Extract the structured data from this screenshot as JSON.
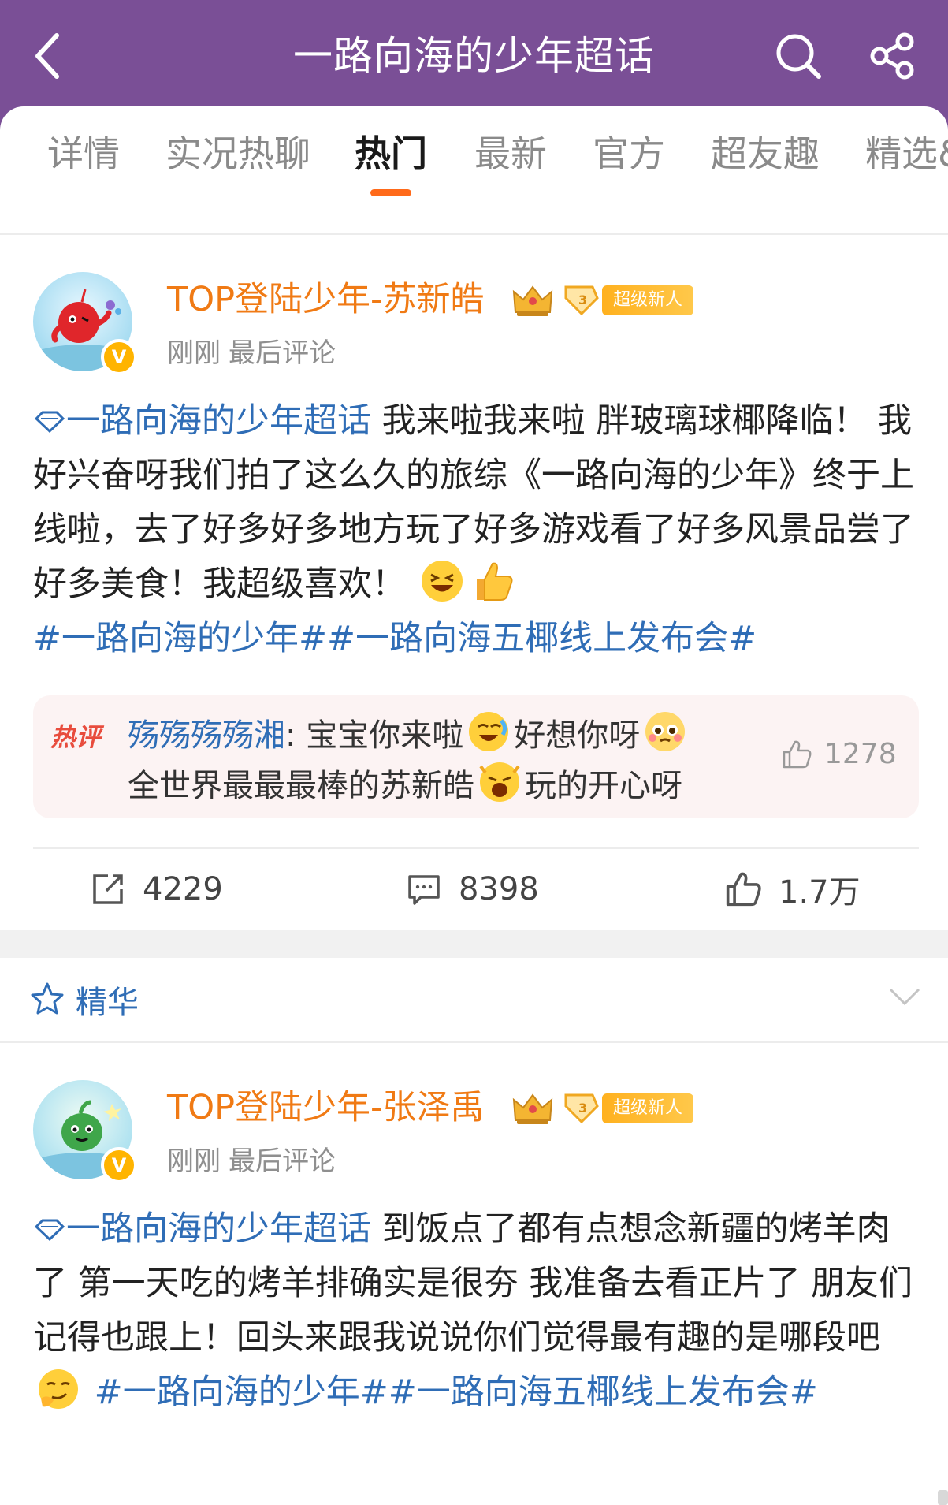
{
  "header": {
    "title": "一路向海的少年超话"
  },
  "tabs": [
    {
      "label": "详情",
      "active": false
    },
    {
      "label": "实况热聊",
      "active": false
    },
    {
      "label": "热门",
      "active": true
    },
    {
      "label": "最新",
      "active": false
    },
    {
      "label": "官方",
      "active": false
    },
    {
      "label": "超友趣",
      "active": false
    },
    {
      "label": "精选&",
      "active": false
    }
  ],
  "post1": {
    "username": "TOP登陆少年-苏新皓",
    "badge": "超级新人",
    "time": "刚刚",
    "meta_suffix": "最后评论",
    "topic_link": "一路向海的少年超话",
    "text_a": "我来啦我来啦 胖玻璃球椰降临！ 我好兴奋呀我们拍了这么久的旅综《一路向海的少年》终于上线啦，去了好多好多地方玩了好多游戏看了好多风景品尝了好多美食！我超级喜欢！",
    "hashtags": "#一路向海的少年##一路向海五椰线上发布会#",
    "hot_comment": {
      "badge": "热评",
      "author": "殇殇殇殇湘",
      "line1a": "宝宝你来啦",
      "line1b": "好想你呀",
      "line2a": "全世界最最最棒的苏新皓",
      "line2b": "玩的开心呀",
      "likes": "1278"
    },
    "reposts": "4229",
    "comments": "8398",
    "likes": "1.7万"
  },
  "section": {
    "label": "精华"
  },
  "post2": {
    "username": "TOP登陆少年-张泽禹",
    "badge": "超级新人",
    "time": "刚刚",
    "meta_suffix": "最后评论",
    "topic_link": "一路向海的少年超话",
    "text_a": "到饭点了都有点想念新疆的烤羊肉了 第一天吃的烤羊排确实是很夯 我准备去看正片了 朋友们记得也跟上！回头来跟我说说你们觉得最有趣的是哪段吧",
    "hashtags": "#一路向海的少年##一路向海五椰线上发布会#"
  },
  "colors": {
    "header_bg": "#7a4f96",
    "accent_orange": "#ff6a1a",
    "username_orange": "#f07a14",
    "link_blue": "#2f6db6"
  }
}
